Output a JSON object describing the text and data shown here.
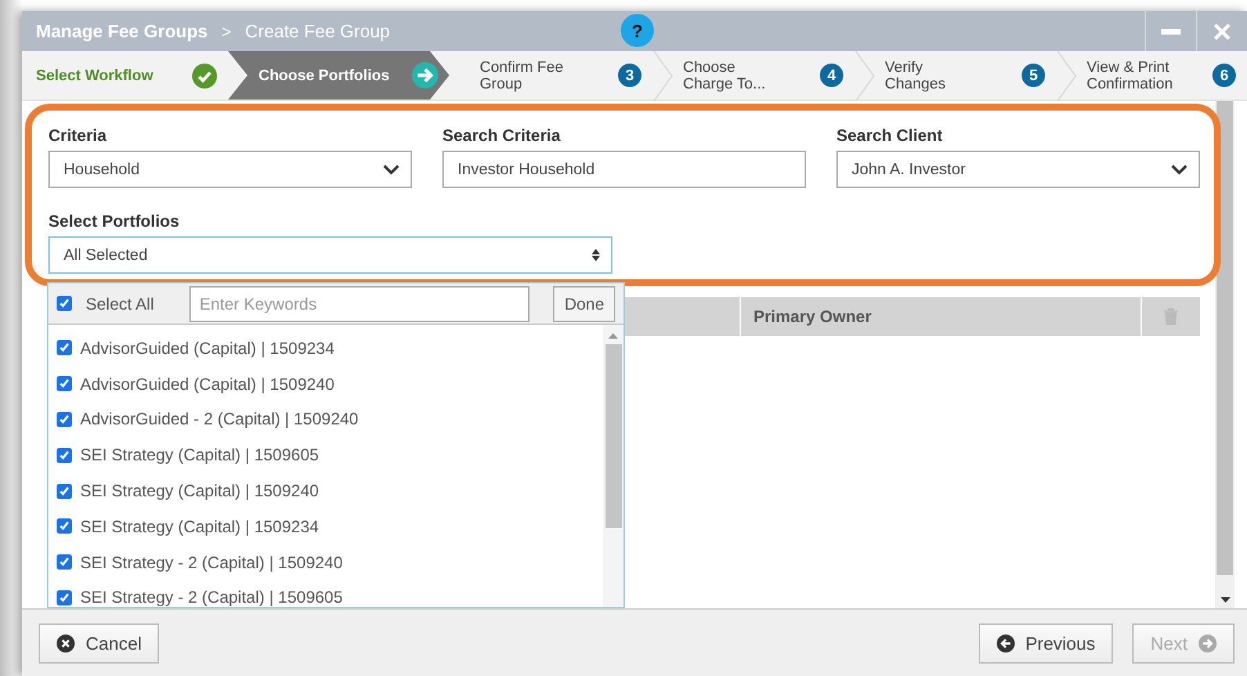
{
  "window": {
    "breadcrumb": [
      {
        "label": "Manage Fee Groups",
        "current": false
      },
      {
        "label": "Create Fee Group",
        "current": true
      }
    ],
    "separator": ">",
    "help": "?"
  },
  "steps": [
    {
      "label": "Select Workflow",
      "completed": true,
      "selected": false
    },
    {
      "label": "Choose Portfolios",
      "completed": false,
      "selected": true
    },
    {
      "label": "Confirm Fee Group",
      "completed": false,
      "selected": false,
      "number": "3"
    },
    {
      "label": "Choose Charge To...",
      "completed": false,
      "selected": false,
      "number": "4"
    },
    {
      "label": "Verify Changes",
      "completed": false,
      "selected": false,
      "number": "5"
    },
    {
      "label": "View & Print Confirmation",
      "completed": false,
      "selected": false,
      "number": "6"
    }
  ],
  "fields": [
    {
      "kind": "select",
      "label": "Criteria",
      "value": "Household"
    },
    {
      "kind": "text",
      "label": "Search Criteria",
      "value": "Investor Household"
    },
    {
      "kind": "select",
      "label": "Search Client",
      "value": "John A. Investor"
    }
  ],
  "select_portfolios": {
    "label": "Select Portfolios",
    "value": "All Selected",
    "expanded": true
  },
  "portfolio_list": {
    "select_all": {
      "label": "Select All",
      "checked": true
    },
    "search": {
      "placeholder": "Enter Keywords"
    },
    "done": "Done",
    "items": [
      {
        "label": "AdvisorGuided (Capital) | 1509234",
        "checked": true
      },
      {
        "label": "AdvisorGuided (Capital) | 1509240",
        "checked": true
      },
      {
        "label": "AdvisorGuided - 2 (Capital) | 1509240",
        "checked": true
      },
      {
        "label": "SEI Strategy (Capital) | 1509605",
        "checked": true
      },
      {
        "label": "SEI Strategy (Capital) | 1509240",
        "checked": true
      },
      {
        "label": "SEI Strategy (Capital) | 1509234",
        "checked": true
      },
      {
        "label": "SEI Strategy - 2 (Capital) | 1509240",
        "checked": true
      },
      {
        "label": "SEI Strategy - 2 (Capital) | 1509605",
        "checked": true
      }
    ]
  },
  "table": {
    "columns": [
      {
        "label": "Primary Owner"
      }
    ]
  },
  "footer": {
    "cancel": {
      "label": "Cancel",
      "disabled": false
    },
    "previous": {
      "label": "Previous",
      "disabled": false
    },
    "next": {
      "label": "Next",
      "disabled": true
    }
  }
}
